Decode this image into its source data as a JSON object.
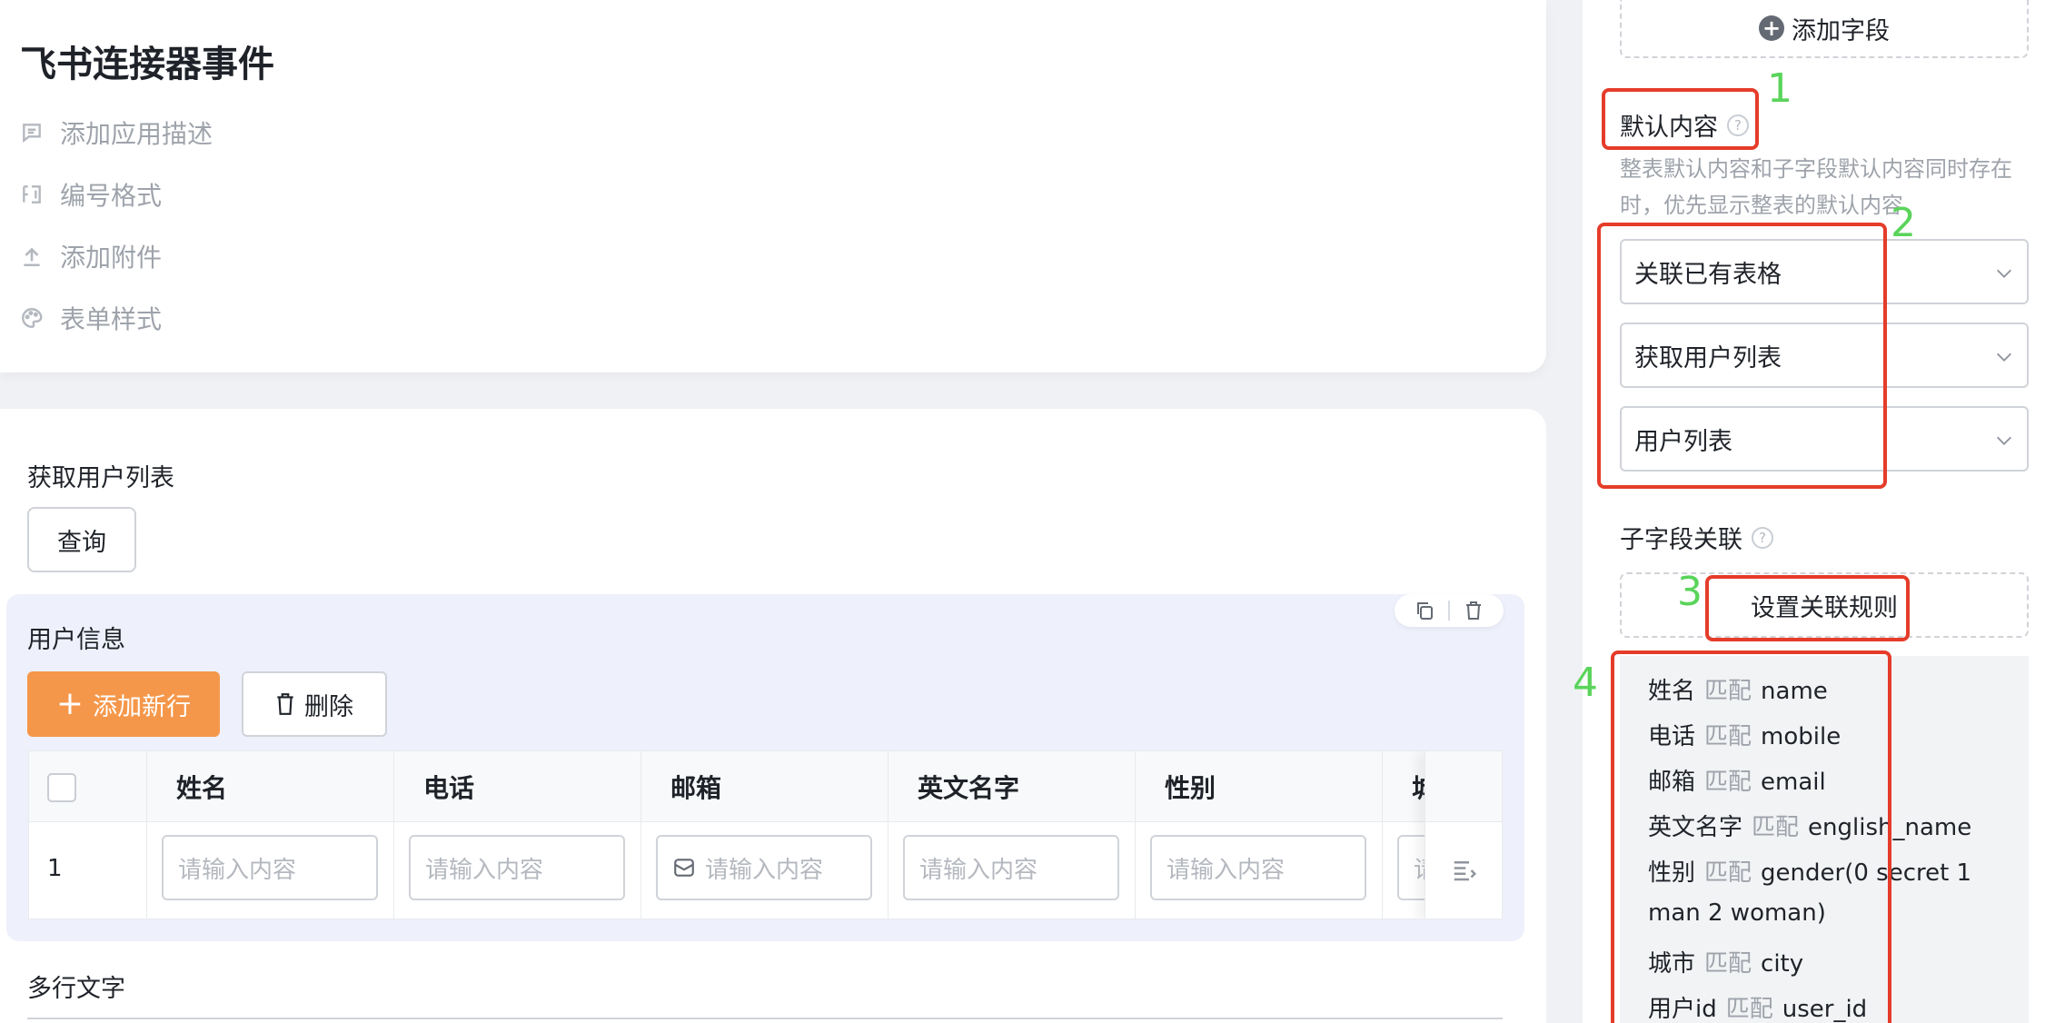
{
  "app": {
    "title": "飞书连接器事件",
    "meta_items": [
      {
        "label": "添加应用描述",
        "icon": "comment-icon"
      },
      {
        "label": "编号格式",
        "icon": "number-format-icon"
      },
      {
        "label": "添加附件",
        "icon": "upload-icon"
      },
      {
        "label": "表单样式",
        "icon": "palette-icon"
      }
    ]
  },
  "form": {
    "section_title": "获取用户列表",
    "query_button": "查询",
    "subform": {
      "title": "用户信息",
      "add_row_label": "添加新行",
      "delete_label": "删除",
      "columns": [
        "姓名",
        "电话",
        "邮箱",
        "英文名字",
        "性别",
        "城"
      ],
      "rows": [
        {
          "index": "1"
        }
      ],
      "input_placeholder": "请输入内容",
      "truncated_placeholder": "请"
    },
    "next_section_title": "多行文字"
  },
  "panel": {
    "add_field_label": "添加字段",
    "default_content_label": "默认内容",
    "default_content_hint": "整表默认内容和子字段默认内容同时存在时，优先显示整表的默认内容",
    "selects": [
      "关联已有表格",
      "获取用户列表",
      "用户列表"
    ],
    "subfield_label": "子字段关联",
    "rules_button": "设置关联规则",
    "match_word": "匹配",
    "rules": [
      {
        "field": "姓名",
        "target": "name"
      },
      {
        "field": "电话",
        "target": "mobile"
      },
      {
        "field": "邮箱",
        "target": "email"
      },
      {
        "field": "英文名字",
        "target": "english_name"
      },
      {
        "field": "性别",
        "target": "gender(0 secret 1"
      },
      {
        "field": "",
        "target": "man 2 woman)"
      },
      {
        "field": "城市",
        "target": "city"
      },
      {
        "field": "用户id",
        "target": "user_id"
      }
    ]
  },
  "annotations": [
    "1",
    "2",
    "3",
    "4"
  ],
  "colors": {
    "accent": "#f5974a",
    "annotation_box": "#e53c2a",
    "annotation_number": "#5ad45a"
  }
}
